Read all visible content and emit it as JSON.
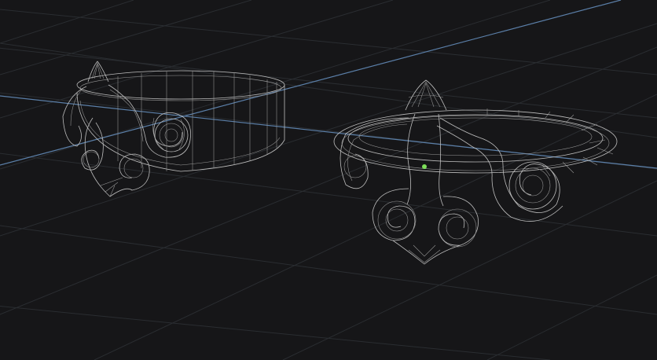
{
  "viewport": {
    "background": "#161618",
    "grid_color": "#2a2d31",
    "axis_color": "#5b7fa8",
    "wireframe_color": "#bdbdbd",
    "pivot_color": "#7ee05a",
    "show_grid": true,
    "display_mode": "wireframe"
  },
  "objects": [
    {
      "name": "ring-left",
      "type": "wireframe-mesh"
    },
    {
      "name": "ring-right",
      "type": "wireframe-mesh",
      "selected_pivot": true
    }
  ]
}
